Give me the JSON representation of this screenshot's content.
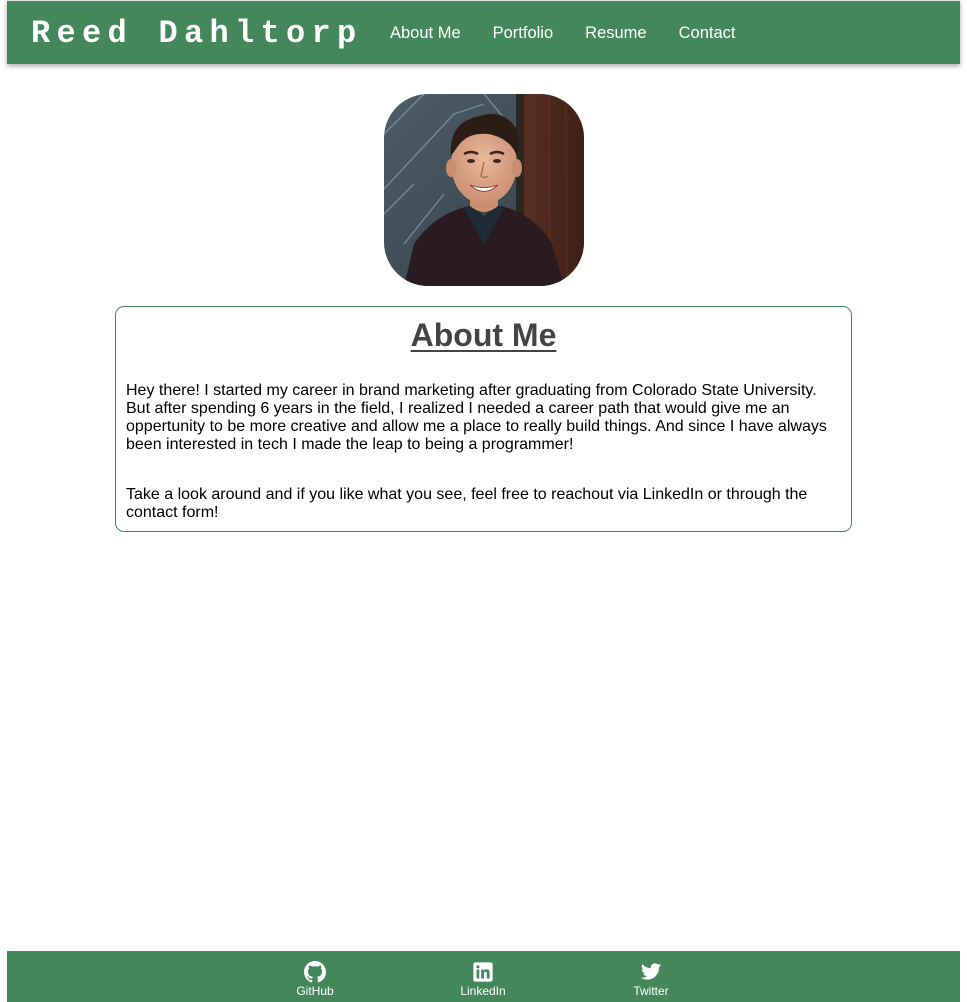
{
  "header": {
    "brand": "Reed Dahltorp",
    "nav": [
      {
        "label": "About Me"
      },
      {
        "label": "Portfolio"
      },
      {
        "label": "Resume"
      },
      {
        "label": "Contact"
      }
    ]
  },
  "profile": {
    "photo_alt": "Reed Dahltorp"
  },
  "about": {
    "title": "About Me",
    "paragraphs": [
      "Hey there! I started my career in brand marketing after graduating from Colorado State University. But after spending 6 years in the field, I realized I needed a career path that would give me an oppertunity to be more creative and allow me a place to really build things. And since I have always been interested in tech I made the leap to being a programmer!",
      "Take a look around and if you like what you see, feel free to reachout via LinkedIn or through the contact form!"
    ]
  },
  "footer": {
    "links": [
      {
        "label": "GitHub",
        "icon": "github-icon"
      },
      {
        "label": "LinkedIn",
        "icon": "linkedin-icon"
      },
      {
        "label": "Twitter",
        "icon": "twitter-icon"
      }
    ]
  },
  "colors": {
    "brand_green": "#44875a",
    "heading_gray": "#444444",
    "white": "#ffffff"
  }
}
